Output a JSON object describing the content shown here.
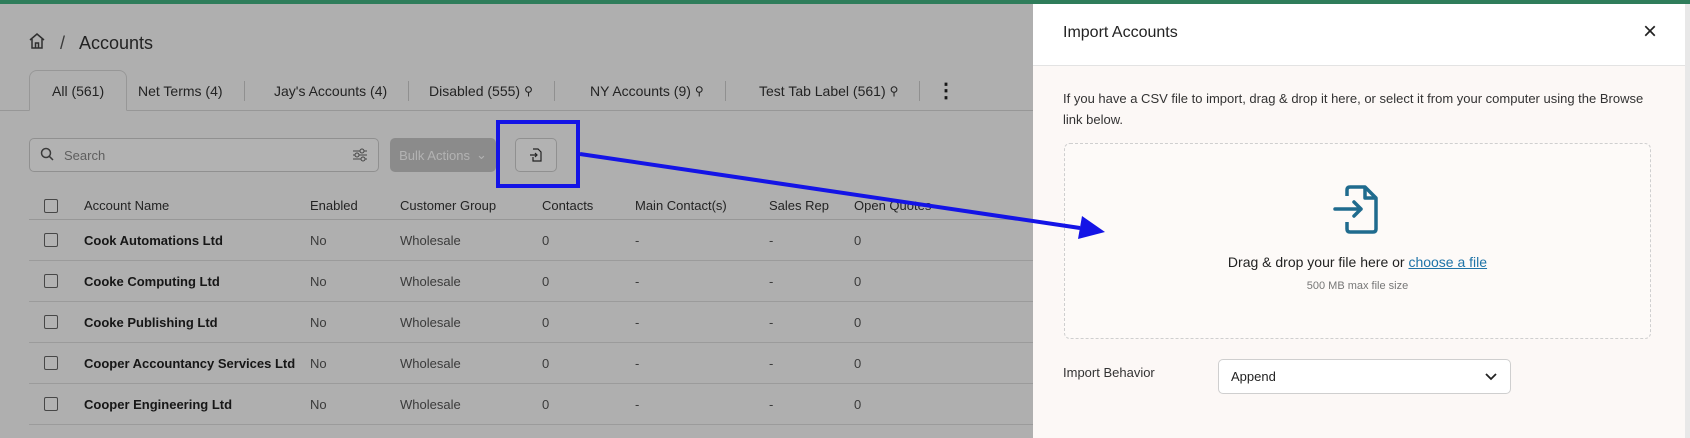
{
  "breadcrumb": {
    "page": "Accounts"
  },
  "tabs": [
    {
      "label": "All (561)",
      "locked": false
    },
    {
      "label": "Net Terms (4)",
      "locked": false
    },
    {
      "label": "Jay's Accounts (4)",
      "locked": false
    },
    {
      "label": "Disabled (555)",
      "locked": true
    },
    {
      "label": "NY Accounts (9)",
      "locked": true
    },
    {
      "label": "Test Tab Label (561)",
      "locked": true
    }
  ],
  "toolbar": {
    "search_placeholder": "Search",
    "bulk_label": "Bulk Actions"
  },
  "table": {
    "headers": [
      "Account Name",
      "Enabled",
      "Customer Group",
      "Contacts",
      "Main Contact(s)",
      "Sales Rep",
      "Open Quotes"
    ],
    "rows": [
      [
        "Cook Automations Ltd",
        "No",
        "Wholesale",
        "0",
        "-",
        "-",
        "0"
      ],
      [
        "Cooke Computing Ltd",
        "No",
        "Wholesale",
        "0",
        "-",
        "-",
        "0"
      ],
      [
        "Cooke Publishing Ltd",
        "No",
        "Wholesale",
        "0",
        "-",
        "-",
        "0"
      ],
      [
        "Cooper Accountancy Services Ltd",
        "No",
        "Wholesale",
        "0",
        "-",
        "-",
        "0"
      ],
      [
        "Cooper Engineering Ltd",
        "No",
        "Wholesale",
        "0",
        "-",
        "-",
        "0"
      ]
    ]
  },
  "panel": {
    "title": "Import Accounts",
    "description": "If you have a CSV file to import, drag & drop it here, or select it from your computer using the Browse link below.",
    "drop_text": "Drag & drop your file here or ",
    "drop_link": "choose a file",
    "max_size": "500 MB max file size",
    "behavior_label": "Import Behavior",
    "behavior_value": "Append"
  },
  "colors": {
    "accent": "#1f74a8",
    "annotation": "#1414e6",
    "topbar": "#2f7d5b"
  }
}
